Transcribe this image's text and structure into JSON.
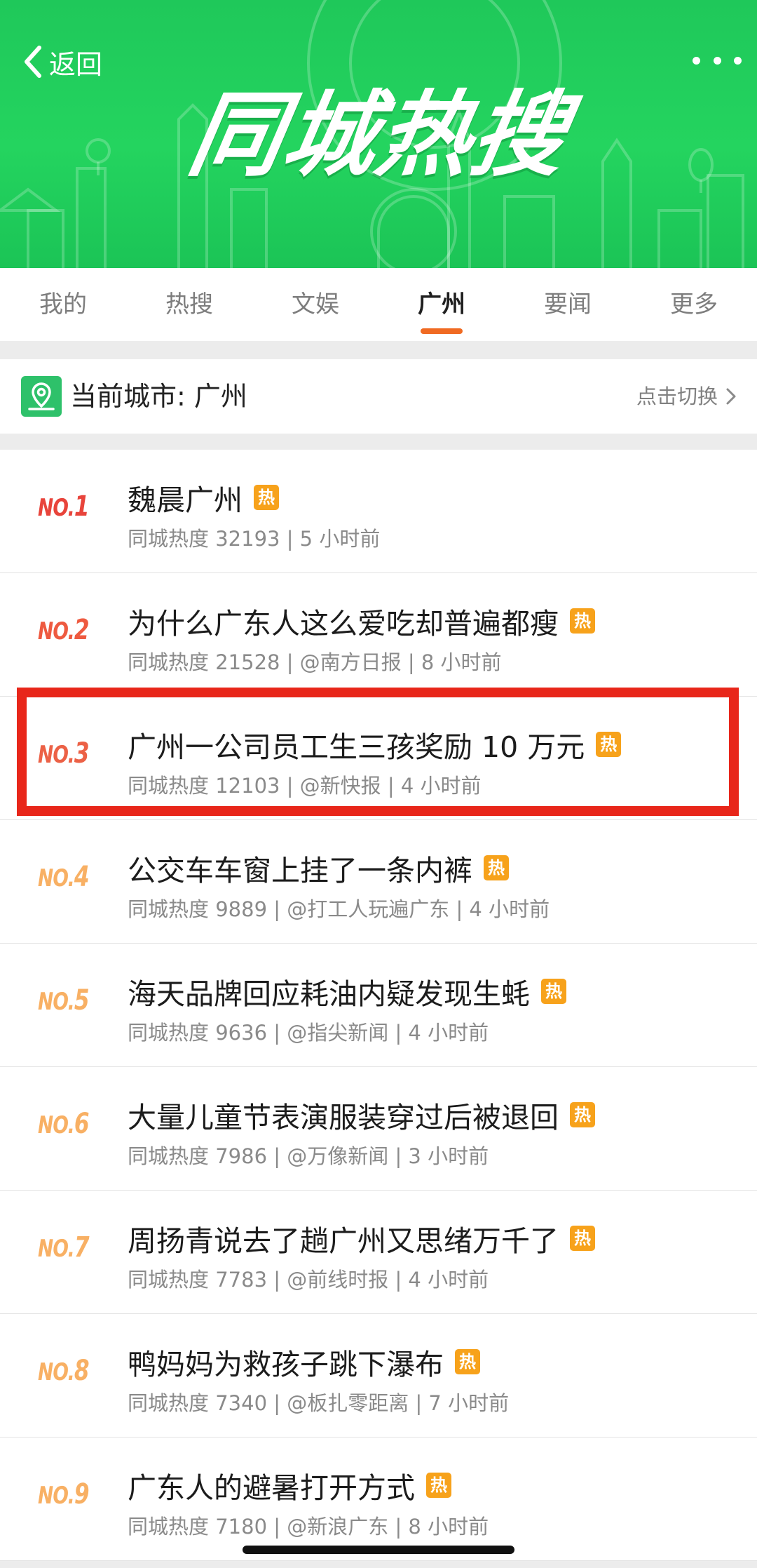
{
  "header": {
    "back_label": "返回",
    "title": "同城热搜",
    "more_icon": "more-dots-icon",
    "colors": {
      "banner": "#24d45f",
      "accent": "#f06a22"
    }
  },
  "tabs": [
    {
      "label": "我的",
      "active": false
    },
    {
      "label": "热搜",
      "active": false
    },
    {
      "label": "文娱",
      "active": false
    },
    {
      "label": "广州",
      "active": true
    },
    {
      "label": "要闻",
      "active": false
    },
    {
      "label": "更多",
      "active": false
    }
  ],
  "city": {
    "label": "当前城市: 广州",
    "switch_label": "点击切换"
  },
  "hot_badge": "热",
  "items": [
    {
      "rank_prefix": "NO.",
      "rank": "1",
      "title": "魏晨广州",
      "meta": "同城热度 32193 | 5 小时前"
    },
    {
      "rank_prefix": "NO.",
      "rank": "2",
      "title": "为什么广东人这么爱吃却普遍都瘦",
      "meta": "同城热度 21528 | @南方日报 | 8 小时前"
    },
    {
      "rank_prefix": "NO.",
      "rank": "3",
      "title": "广州一公司员工生三孩奖励 10 万元",
      "meta": "同城热度 12103 | @新快报 | 4 小时前"
    },
    {
      "rank_prefix": "NO.",
      "rank": "4",
      "title": "公交车车窗上挂了一条内裤",
      "meta": "同城热度 9889 | @打工人玩遍广东 | 4 小时前"
    },
    {
      "rank_prefix": "NO.",
      "rank": "5",
      "title": "海天品牌回应耗油内疑发现生蚝",
      "meta": "同城热度 9636 | @指尖新闻 | 4 小时前"
    },
    {
      "rank_prefix": "NO.",
      "rank": "6",
      "title": "大量儿童节表演服装穿过后被退回",
      "meta": "同城热度 7986 | @万像新闻 | 3 小时前"
    },
    {
      "rank_prefix": "NO.",
      "rank": "7",
      "title": "周扬青说去了趟广州又思绪万千了",
      "meta": "同城热度 7783 | @前线时报 | 4 小时前"
    },
    {
      "rank_prefix": "NO.",
      "rank": "8",
      "title": "鸭妈妈为救孩子跳下瀑布",
      "meta": "同城热度 7340 | @板扎零距离 | 7 小时前"
    },
    {
      "rank_prefix": "NO.",
      "rank": "9",
      "title": "广东人的避暑打开方式",
      "meta": "同城热度 7180 | @新浪广东 | 8 小时前"
    }
  ]
}
